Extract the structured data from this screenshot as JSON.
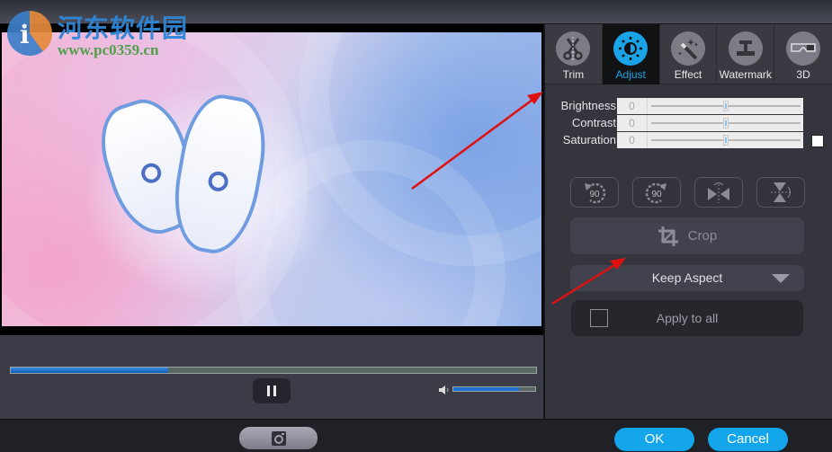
{
  "watermark": {
    "site_name": "河东软件园",
    "url": "www.pc0359.cn",
    "logo_glyph": "i"
  },
  "player": {
    "progress_percent": 30,
    "volume_percent": 80,
    "pause_icon": "pause-icon",
    "volume_icon": "speaker-icon"
  },
  "tabs": [
    {
      "label": "Trim",
      "icon": "scissors-icon",
      "active": false
    },
    {
      "label": "Adjust",
      "icon": "brightness-icon",
      "active": true
    },
    {
      "label": "Effect",
      "icon": "magic-wand-icon",
      "active": false
    },
    {
      "label": "Watermark",
      "icon": "watermark-icon",
      "active": false
    },
    {
      "label": "3D",
      "icon": "3d-glasses-icon",
      "active": false
    }
  ],
  "adjust": {
    "rows": [
      {
        "label": "Brightness",
        "value": "0",
        "position_percent": 50
      },
      {
        "label": "Contrast",
        "value": "0",
        "position_percent": 50
      },
      {
        "label": "Saturation",
        "value": "0",
        "position_percent": 50
      }
    ],
    "checkbox_checked": false
  },
  "tools": {
    "rotate_left_label": "90",
    "rotate_right_label": "90",
    "crop_label": "Crop",
    "aspect_selected": "Keep Aspect",
    "apply_all_label": "Apply to all"
  },
  "footer": {
    "ok_label": "OK",
    "cancel_label": "Cancel"
  },
  "colors": {
    "accent": "#13a6ec",
    "panel_bg": "#35363d",
    "annotation_arrow": "#e01010"
  }
}
